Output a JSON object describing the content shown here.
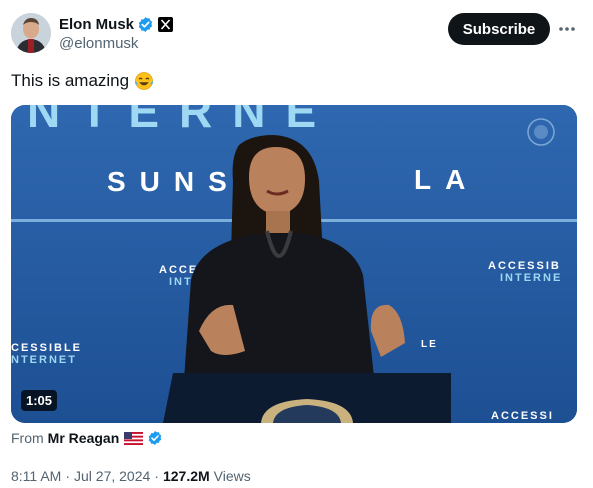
{
  "author": {
    "display_name": "Elon Musk",
    "handle": "@elonmusk",
    "avatar_icon": "avatar-photo",
    "verified_icon": "verified-badge-icon",
    "affiliation_icon": "x-logo-icon"
  },
  "actions": {
    "subscribe_label": "Subscribe",
    "more_icon": "more-options-icon"
  },
  "tweet": {
    "text": "This is amazing",
    "emoji": "😂"
  },
  "media": {
    "type": "video",
    "duration": "1:05",
    "sign_texts": [
      "NTERNE",
      "SUNS",
      "LA",
      "ACCES",
      "INTE",
      "ACCESSIB",
      "INTERNE",
      "CESSIBLE",
      "NTERNET",
      "LE",
      "ACCESSI"
    ]
  },
  "source": {
    "prefix": "From",
    "name": "Mr Reagan",
    "flag": "us-flag",
    "verified_icon": "verified-badge-icon"
  },
  "meta": {
    "time": "8:11 AM",
    "date": "Jul 27, 2024",
    "separator": "·",
    "views_count": "127.2M",
    "views_label": "Views"
  },
  "colors": {
    "accent_blue": "#1d9bf0",
    "text_primary": "#0f1419",
    "text_secondary": "#536471",
    "banner_blue": "#2d63a8"
  }
}
